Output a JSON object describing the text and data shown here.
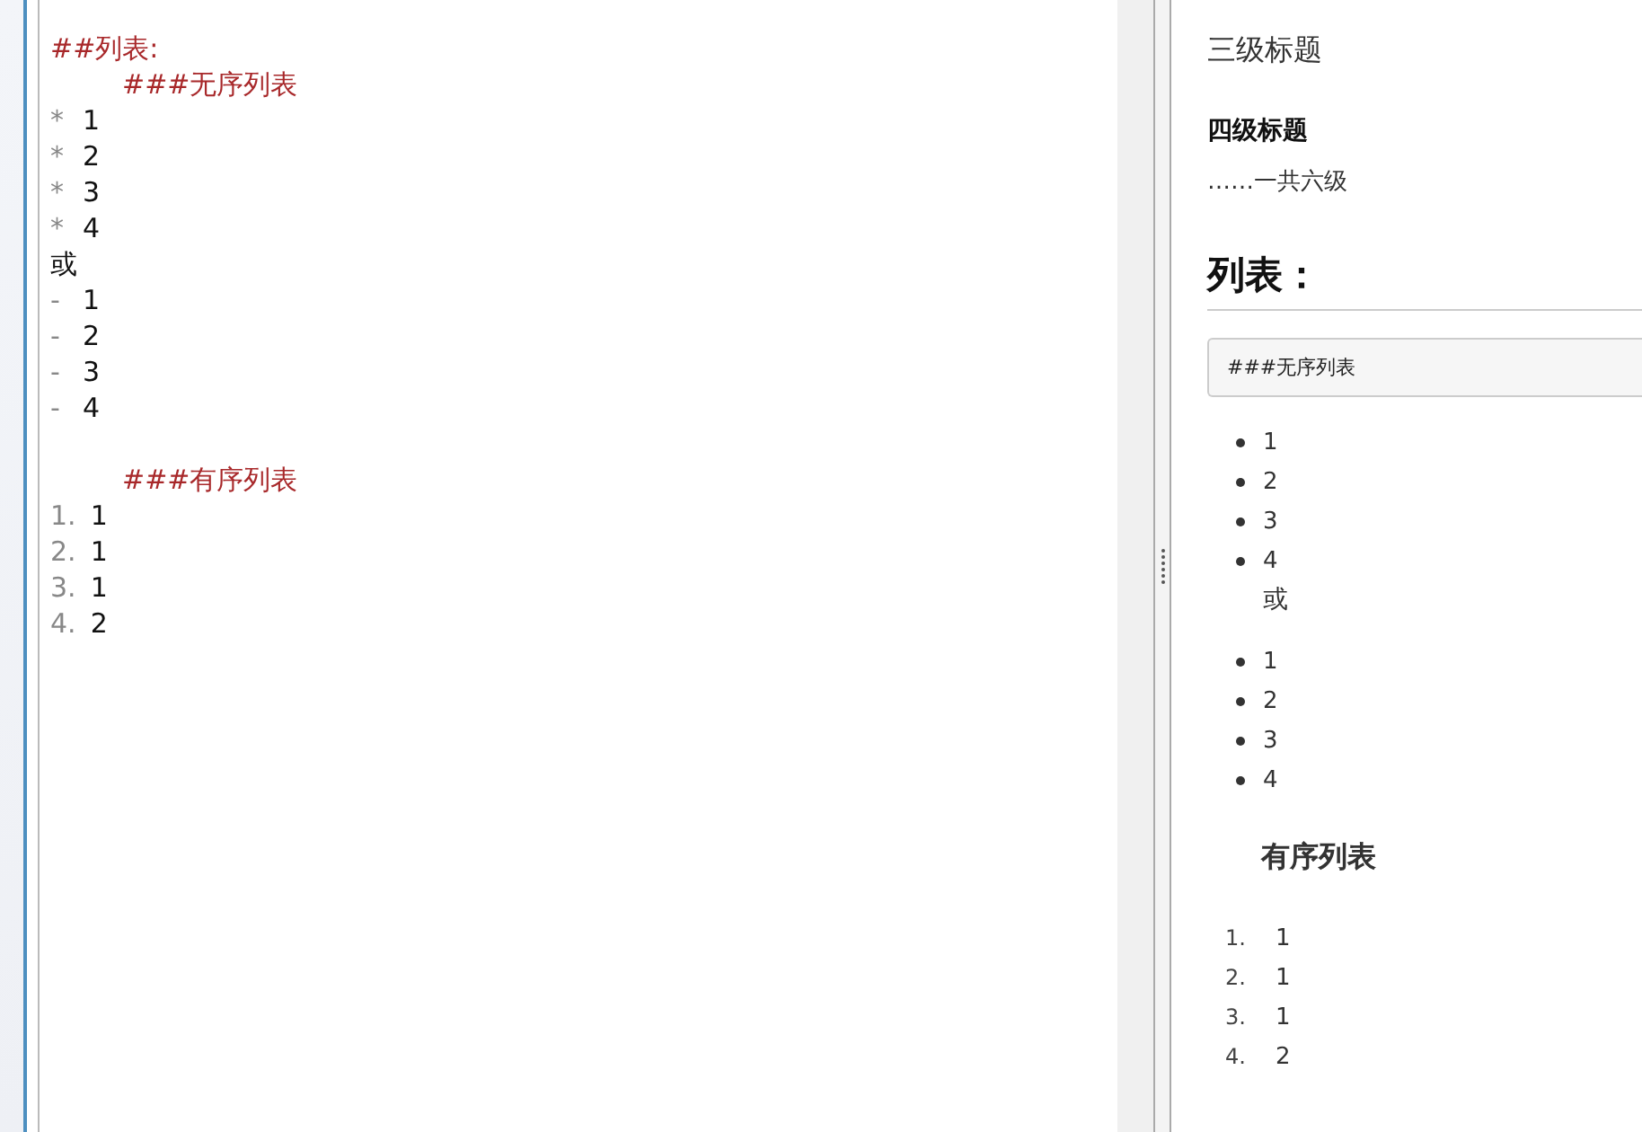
{
  "editor": {
    "lines": [
      {
        "kind": "heading",
        "indented": false,
        "text": "##列表:"
      },
      {
        "kind": "heading",
        "indented": true,
        "text": "###无序列表"
      },
      {
        "kind": "item",
        "marker": "*",
        "text": "1"
      },
      {
        "kind": "item",
        "marker": "*",
        "text": "2"
      },
      {
        "kind": "item",
        "marker": "*",
        "text": "3"
      },
      {
        "kind": "item",
        "marker": "*",
        "text": "4"
      },
      {
        "kind": "plain",
        "text": "或"
      },
      {
        "kind": "item",
        "marker": "-",
        "text": "1"
      },
      {
        "kind": "item",
        "marker": "-",
        "text": "2"
      },
      {
        "kind": "item",
        "marker": "-",
        "text": "3"
      },
      {
        "kind": "item",
        "marker": "-",
        "text": "4"
      },
      {
        "kind": "blank"
      },
      {
        "kind": "heading",
        "indented": true,
        "text": "###有序列表"
      },
      {
        "kind": "item",
        "marker": "1.",
        "text": "1"
      },
      {
        "kind": "item",
        "marker": "2.",
        "text": "1"
      },
      {
        "kind": "item",
        "marker": "3.",
        "text": "1"
      },
      {
        "kind": "item",
        "marker": "4.",
        "text": "2"
      }
    ]
  },
  "preview": {
    "blocks": [
      {
        "kind": "h3",
        "text": "三级标题"
      },
      {
        "kind": "h4",
        "text": "四级标题"
      },
      {
        "kind": "p",
        "text": "……一共六级"
      },
      {
        "kind": "h2",
        "text": "列表："
      },
      {
        "kind": "code",
        "text": "###无序列表"
      },
      {
        "kind": "ul",
        "items": [
          "1",
          "2",
          "3",
          "4"
        ],
        "after": "或"
      },
      {
        "kind": "ul",
        "items": [
          "1",
          "2",
          "3",
          "4"
        ]
      },
      {
        "kind": "h3-indented",
        "text": "有序列表"
      },
      {
        "kind": "ol",
        "markers": [
          "1.",
          "2.",
          "3.",
          "4."
        ],
        "items": [
          "1",
          "1",
          "1",
          "2"
        ]
      }
    ]
  }
}
